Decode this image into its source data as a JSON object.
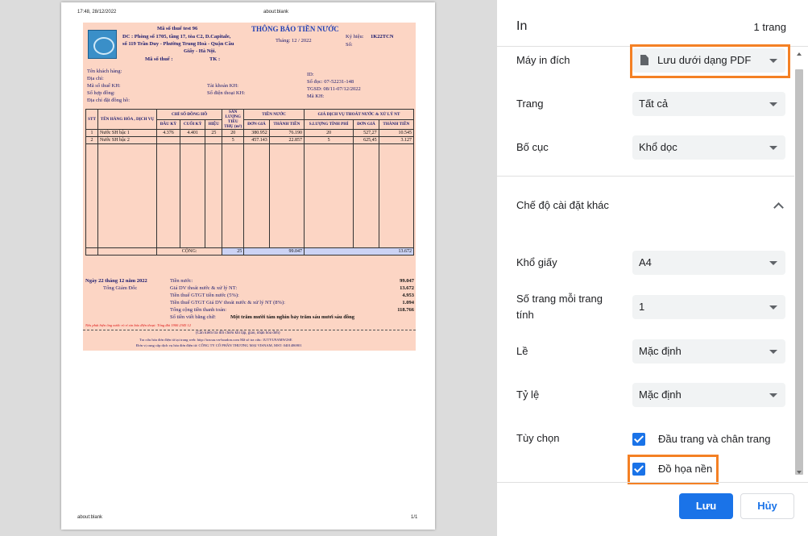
{
  "preview": {
    "header_left": "17:48, 28/12/2022",
    "header_center": "about:blank",
    "footer_left": "about:blank",
    "footer_right": "1/1",
    "invoice": {
      "tax_code_line": "Mã số thuế test 96",
      "title": "THÔNG BÁO TIỀN NƯỚC",
      "address_1": "DC : Phòng số 1705, tầng 17, tòa C2, D.Capitale,",
      "address_2": "số 119 Trần Duy - Phường Trung Hoà - Quận Cầu",
      "address_3": "Giấy - Hà Nội.",
      "tax_code_2": "Mã số thuế :",
      "tel": "TK :",
      "month": "Tháng: 12 / 2022",
      "symbol_label": "Ký hiệu:",
      "symbol_value": "1K22TCN",
      "number_label": "Số:",
      "customer_name": "Tên khách hàng:",
      "address": "Địa chỉ:",
      "customer_tax": "Mã số thuế KH:",
      "contract": "Số hợp đồng:",
      "meter_address": "Địa chỉ đặt đồng hồ:",
      "account": "Tài khoản KH:",
      "phone": "Số điện thoại KH:",
      "id": "ID:",
      "read_no": "Số đọc: 07-52231-148",
      "tgsd": "TGSD: 08/11-07/12/2022",
      "customer_code": "Mã KH:",
      "table_headers": {
        "stt": "STT",
        "name": "TÊN HÀNG HÓA , DỊCH VỤ",
        "meter": "CHỈ SỐ ĐỒNG HỒ",
        "first": "ĐẦU KỲ",
        "last": "CUỐI KỲ",
        "diff": "HIỆU",
        "volume": "SẢN LƯỢNG TIÊU THỤ (m³)",
        "water_fee": "TIỀN NƯỚC",
        "unit_price": "ĐƠN GIÁ",
        "amount": "THÀNH TIỀN",
        "drainage": "GIÁ DỊCH VỤ THOÁT NƯỚC & XỬ LÝ NT",
        "fee_volume": "S.LƯỢNG TÍNH PHÍ",
        "unit_price_2": "ĐƠN GIÁ",
        "amount_2": "THÀNH TIỀN"
      },
      "rows": [
        [
          "1",
          "Nước SH bậc 1",
          "4.376",
          "4.401",
          "25",
          "20",
          "380.952",
          "76.190",
          "20",
          "527,27",
          "10.545"
        ],
        [
          "2",
          "Nước SH bậc 2",
          "",
          "",
          "",
          "5",
          "457.143",
          "22.857",
          "5",
          "625,45",
          "3.127"
        ]
      ],
      "total_label": "CỘNG:",
      "total_volume": "25",
      "total_water": "99.047",
      "total_drain": "13.672",
      "date_line": "Ngày 22 tháng 12 năm 2022",
      "director": "Tổng Giám Đốc",
      "sum_water_label": "Tiền nước:",
      "sum_water": "99.047",
      "sum_drain_label": "Giá DV thoát nước & xử lý NT:",
      "sum_drain": "13.672",
      "vat_label": "Tiền thuế GTGT tiền nước (5%):",
      "vat": "4.953",
      "vat_drain_label": "Tiền thuế GTGT Giá DV thoát nước & xử lý NT (8%):",
      "vat_drain": "1.094",
      "grand_label": "Tổng cộng tiền thanh toán:",
      "grand": "118.766",
      "words_label": "Số tiền viết bằng chữ:",
      "words": "Một trăm mười tám nghìn bảy trăm sáu mươi sáu đồng",
      "red_note": "Nếu phát hiện ống nước rò rỉ xin báo điện thoại: Tổng đài 1900 2345 12",
      "check_note": "(Cần kiểm tra đối chiếu khi lập, giao, nhận hóa đơn)",
      "lookup": "Tra cứu hóa đơn điện tử tại trang web: http://tracuu.vn-hoadon.com  Mã số tra cứu: 1UTYU9AMW2SE",
      "provider": "Đơn vị cung cấp dịch vụ hóa đơn điện tử: CÔNG TY CỔ PHẦN THƯƠNG MẠI VISNAM, MST: 0401486901"
    }
  },
  "panel": {
    "title": "In",
    "page_count": "1 trang",
    "destination_label": "Máy in đích",
    "destination_value": "Lưu dưới dạng PDF",
    "pages_label": "Trang",
    "pages_value": "Tất cả",
    "layout_label": "Bố cục",
    "layout_value": "Khổ dọc",
    "more_settings": "Chế độ cài đặt khác",
    "paper_label": "Khổ giấy",
    "paper_value": "A4",
    "pps_label_1": "Số trang mỗi trang",
    "pps_label_2": "tính",
    "pps_value": "1",
    "margins_label": "Lề",
    "margins_value": "Mặc định",
    "scale_label": "Tỷ lệ",
    "scale_value": "Mặc định",
    "options_label": "Tùy chọn",
    "headers_footers": "Đầu trang và chân trang",
    "background_graphics": "Đồ họa nền",
    "save_button": "Lưu",
    "cancel_button": "Hủy",
    "highlight_color": "#f48024",
    "accent_color": "#1a73e8"
  }
}
